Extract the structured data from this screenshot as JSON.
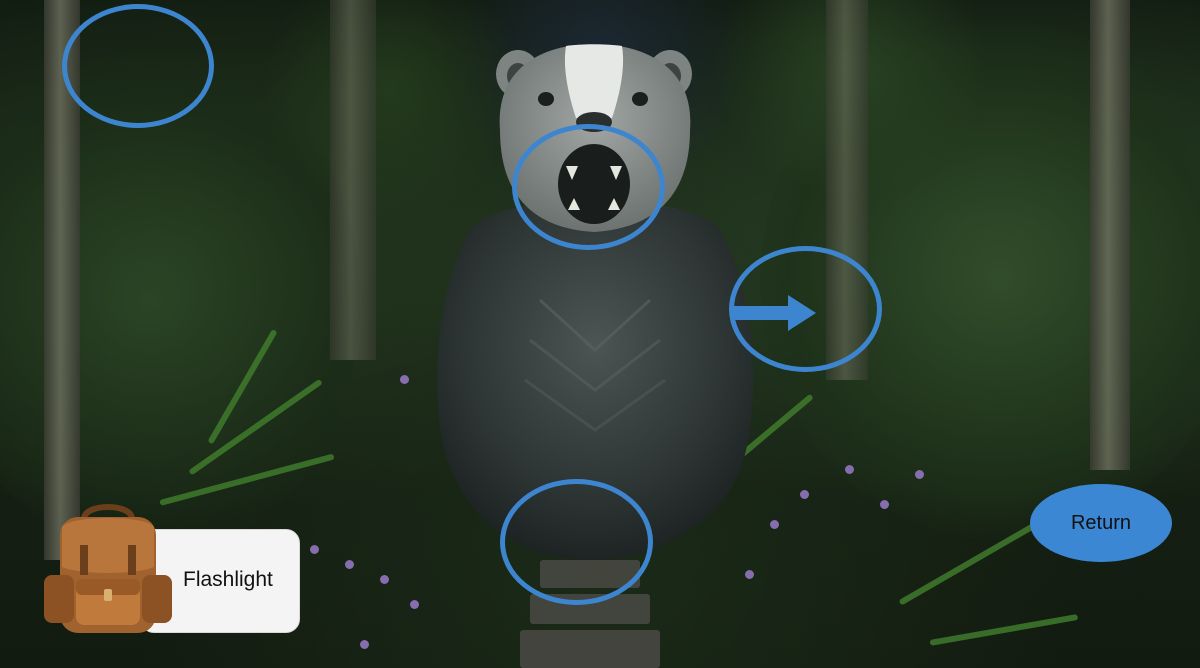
{
  "scene": {
    "inventory": {
      "item_label": "Flashlight",
      "item_icon": "backpack-icon"
    },
    "return_label": "Return",
    "hotspots": [
      {
        "name": "treetop-hotspot"
      },
      {
        "name": "statue-mouth-hotspot"
      },
      {
        "name": "right-path-hotspot"
      },
      {
        "name": "ground-hotspot"
      }
    ],
    "navigation": {
      "arrow_icon": "arrow-right-icon",
      "direction": "right"
    },
    "colors": {
      "hotspot_ring": "#3d86cf",
      "return_button": "#3c87d3",
      "inventory_card": "#f4f4f4"
    }
  }
}
